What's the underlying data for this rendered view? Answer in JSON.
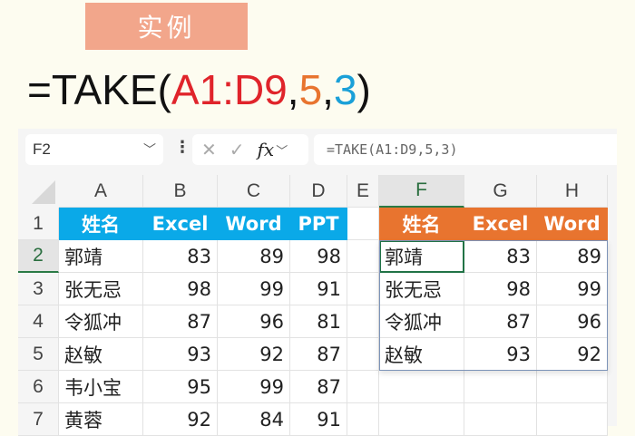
{
  "badge": "实例",
  "formula_display": {
    "prefix": "=TAKE(",
    "range": "A1:D9",
    "sep1": ",",
    "rows": "5",
    "sep2": ",",
    "cols": "3",
    "suffix": ")"
  },
  "toolbar": {
    "name_box": "F2",
    "formula": "=TAKE(A1:D9,5,3)",
    "cancel": "✕",
    "enter": "✓",
    "fx": "fx"
  },
  "columns": [
    "A",
    "B",
    "C",
    "D",
    "E",
    "F",
    "G",
    "H"
  ],
  "rows": [
    "1",
    "2",
    "3",
    "4",
    "5",
    "6",
    "7"
  ],
  "source": {
    "headers": [
      "姓名",
      "Excel",
      "Word",
      "PPT"
    ],
    "data": [
      [
        "郭靖",
        "83",
        "89",
        "98"
      ],
      [
        "张无忌",
        "98",
        "99",
        "91"
      ],
      [
        "令狐冲",
        "87",
        "96",
        "81"
      ],
      [
        "赵敏",
        "93",
        "92",
        "87"
      ],
      [
        "韦小宝",
        "95",
        "99",
        "87"
      ],
      [
        "黄蓉",
        "92",
        "84",
        "91"
      ]
    ]
  },
  "result": {
    "headers": [
      "姓名",
      "Excel",
      "Word"
    ],
    "data": [
      [
        "郭靖",
        "83",
        "89"
      ],
      [
        "张无忌",
        "98",
        "99"
      ],
      [
        "令狐冲",
        "87",
        "96"
      ],
      [
        "赵敏",
        "93",
        "92"
      ]
    ]
  },
  "colors": {
    "source_header": "#0aa9e8",
    "result_header": "#e8742f",
    "badge": "#f2a68b"
  }
}
